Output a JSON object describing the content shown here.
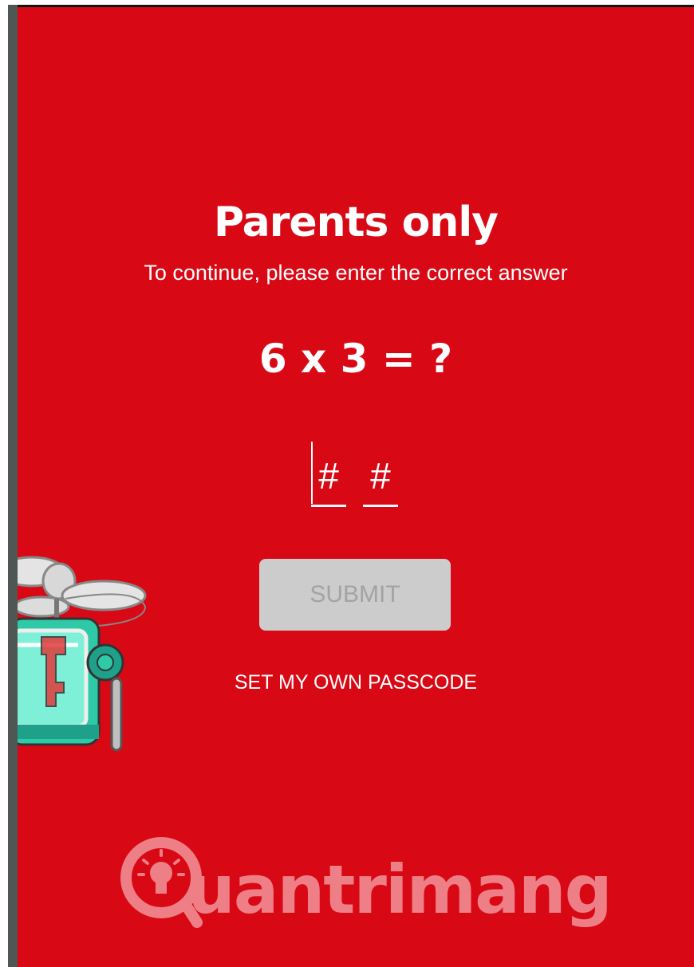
{
  "dialog": {
    "title": "Parents only",
    "subtitle": "To continue, please enter the correct answer",
    "question": "6 x 3 = ?",
    "inputs": [
      {
        "placeholder": "#",
        "value": ""
      },
      {
        "placeholder": "#",
        "value": ""
      }
    ],
    "submit_label": "SUBMIT",
    "passcode_link": "SET MY OWN PASSCODE"
  },
  "watermark": {
    "text": "uantrimang",
    "icon": "lightbulb-icon"
  },
  "colors": {
    "background": "#d80915",
    "submit_bg": "#cccccc",
    "submit_text": "#a3a3a3",
    "mascot_body": "#2ec9a6",
    "watermark": "#ee7f86"
  }
}
